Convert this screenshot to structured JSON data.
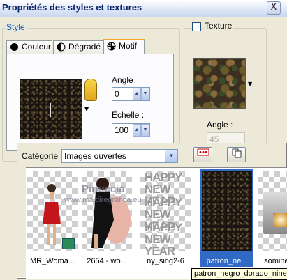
{
  "window": {
    "title": "Propriétés des styles et textures",
    "close_label": "X"
  },
  "style_group": {
    "label": "Style",
    "tabs": [
      {
        "label": "Couleur"
      },
      {
        "label": "Dégradé"
      },
      {
        "label": "Motif"
      }
    ],
    "angle_label": "Angle",
    "angle_value": "0",
    "scale_label": "Échelle :",
    "scale_value": "100"
  },
  "texture_group": {
    "label": "Texture",
    "checked": false,
    "angle_label": "Angle :",
    "angle_value": "45"
  },
  "popup": {
    "category_label": "Catégorie :",
    "category_value": "Images ouvertes",
    "items": [
      {
        "caption": "MR_Woma...",
        "selected": false
      },
      {
        "caption": "2654 - wo...",
        "selected": false
      },
      {
        "caption": "ny_sing2-6",
        "selected": false,
        "text_lines": [
          "HAPPY",
          "NEW YEAR",
          "HAPPY",
          "NEW YEAR",
          "HAPPY",
          "NEW YEAR"
        ]
      },
      {
        "caption": "patron_ne...",
        "selected": true
      },
      {
        "caption": "somine tub",
        "selected": false
      }
    ],
    "watermark": [
      "Pinuccia",
      "www.maidiregrafica.eu"
    ],
    "tooltip": "patron_negro_dorado_nine"
  }
}
